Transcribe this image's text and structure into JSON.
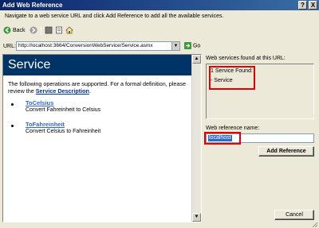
{
  "window": {
    "title": "Add Web Reference",
    "help_label": "?",
    "close_label": "X"
  },
  "instruction": "Navigate to a web service URL and click Add Reference to add all the available services.",
  "toolbar": {
    "back_label": "Back"
  },
  "url_bar": {
    "label": "URL:",
    "value": "http://localhost:3664/ConversionWebService/Service.asmx",
    "go_label": "Go"
  },
  "browser": {
    "banner_title": "Service",
    "intro_text": "The following operations are supported. For a formal definition, please review the ",
    "intro_link": "Service Description",
    "intro_end": ".",
    "operations": [
      {
        "name": "ToCelsius",
        "description": "Convert Fahreinheit to Celsius"
      },
      {
        "name": "ToFahreinheit",
        "description": "Convert Celsius to Fahreinheit"
      }
    ]
  },
  "services_panel": {
    "label": "Web services found at this URL:",
    "count_text": "1 Service Found:",
    "service_item": "- Service"
  },
  "reference": {
    "label": "Web reference name:",
    "value": "localhost",
    "add_button": "Add Reference"
  },
  "footer": {
    "cancel_button": "Cancel"
  },
  "colors": {
    "banner": "#003366",
    "highlight": "#e00000",
    "link": "#3366cc",
    "selection": "#316ac5"
  }
}
